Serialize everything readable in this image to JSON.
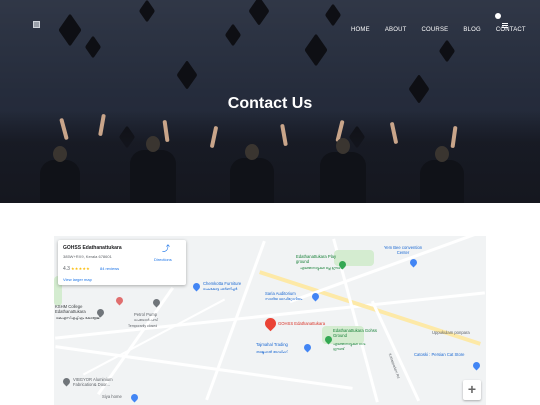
{
  "nav": {
    "items": [
      {
        "label": "HOME"
      },
      {
        "label": "ABOUT"
      },
      {
        "label": "COURSE"
      },
      {
        "label": "BLOG"
      },
      {
        "label": "CONTACT"
      }
    ]
  },
  "hero": {
    "title": "Contact Us"
  },
  "map": {
    "card": {
      "name": "GOHSS Edathanattukara",
      "address": "385W+RX9, Kerala 678601",
      "rating": "4.3",
      "stars": "★★★★★",
      "reviews": "84 reviews",
      "larger_map": "View larger map",
      "directions": "Directions"
    },
    "places": {
      "yem_bee": "Yem Bee convention Center",
      "play_ground": "Edathanattukara Play ground",
      "play_ground_ml": "എടത്തനാട്ടുകര പ്ലേ ഗ്രൗണ്ട്",
      "chemkotta": "Chemkotta Furniture",
      "chemkotta_ml": "ചെംകോട്ട ഫർണിച്ചർ",
      "saria": "Saria Auditorium",
      "saria_ml": "സാരിയ ഓഡിറ്റോറിയം",
      "kshm": "KSHM College Edathanattukara",
      "kshm_ml": "കെഎസ്എച്ച്എം കോളേജ്",
      "petrol": "Petrol Pump",
      "petrol_ml": "പെട്രോൾ പമ്പ്",
      "petrol_status": "Temporarily closed",
      "gohss": "GOHSS Edathanattukara",
      "gohss_ground": "Edathanattukara Gohss Ground",
      "gohss_ground_ml": "എടത്തനാട്ടുകര ഗവ. ഗ്രൗണ്ട്",
      "tajmahal": "Tajmahal Trading",
      "tajmahal_ml": "താജ്മഹൽ ട്രേഡിംഗ്",
      "uppukulam": "Uppukulam ponpara",
      "catoski": "Catoski : Persian Cat Store",
      "vibgyor": "VIBGYOR Aluminium Fabrication& Door...",
      "siya": "Siya home",
      "road_label": "Kottappadam Rd"
    },
    "zoom_label": "+"
  }
}
